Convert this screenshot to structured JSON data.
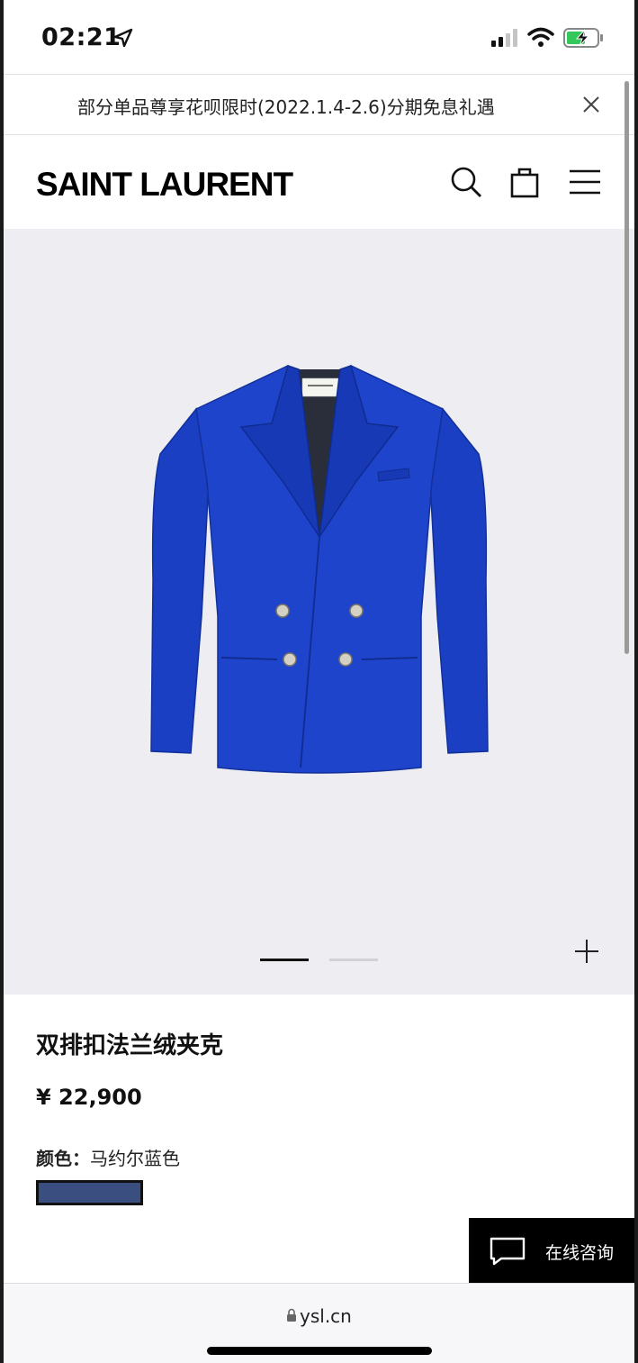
{
  "status_bar": {
    "time": "02:21"
  },
  "promo": {
    "text": "部分单品尊享花呗限时(2022.1.4-2.6)分期免息礼遇"
  },
  "header": {
    "brand": "SAINT LAURENT"
  },
  "product": {
    "title": "双排扣法兰绒夹克",
    "price": "¥ 22,900",
    "color_label": "颜色：",
    "color_value": "马约尔蓝色",
    "swatch_color": "#3a4f80",
    "jacket_color": "#1a3fc2",
    "carousel": {
      "count": 2,
      "active_index": 0
    }
  },
  "chat": {
    "label": "在线咨询"
  },
  "browser": {
    "url": "ysl.cn"
  }
}
